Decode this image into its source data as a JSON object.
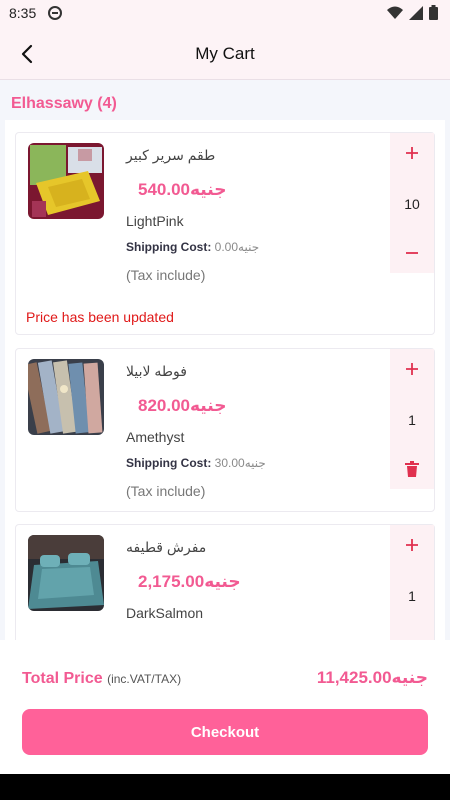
{
  "status_bar": {
    "time": "8:35"
  },
  "app_bar": {
    "title": "My Cart"
  },
  "seller": {
    "name": "Elhassawy",
    "count": "(4)"
  },
  "items": [
    {
      "name": "طقم سرير كبير",
      "price": "540.00جنيه",
      "color": "LightPink",
      "shipping_label": "Shipping Cost:",
      "shipping_value": "0.00جنيه",
      "tax": "(Tax include)",
      "quantity": "10",
      "warning": "Price has been updated",
      "decrement": "minus"
    },
    {
      "name": "فوطه لابيلا",
      "price": "820.00جنيه",
      "color": "Amethyst",
      "shipping_label": "Shipping Cost:",
      "shipping_value": "30.00جنيه",
      "tax": "(Tax include)",
      "quantity": "1",
      "decrement": "trash"
    },
    {
      "name": "مفرش قطيفه",
      "price": "2,175.00جنيه",
      "color": "DarkSalmon",
      "quantity": "1"
    }
  ],
  "summary": {
    "total_label": "Total Price",
    "total_note": "(inc.VAT/TAX)",
    "total_value": "11,425.00جنيه",
    "checkout_label": "Checkout"
  },
  "colors": {
    "accent": "#f25a92",
    "button": "#ff6199",
    "warning": "#e01919"
  }
}
